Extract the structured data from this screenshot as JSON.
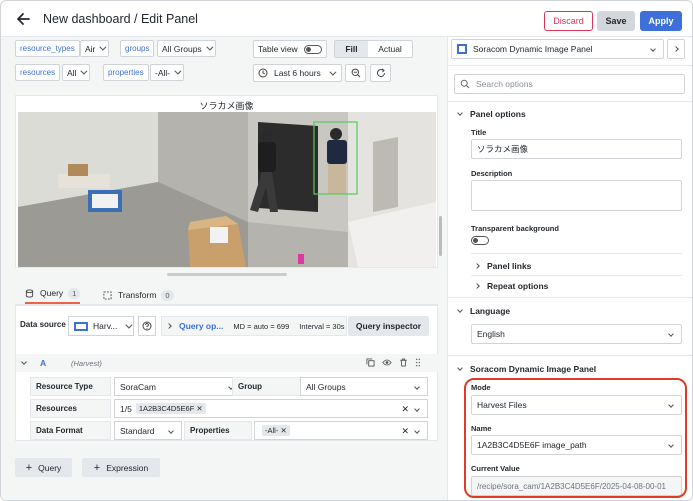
{
  "header": {
    "title": "New dashboard / Edit Panel",
    "discard_label": "Discard",
    "save_label": "Save",
    "apply_label": "Apply"
  },
  "variables": {
    "resource_types_label": "resource_types",
    "resource_types_value": "Air",
    "groups_label": "groups",
    "groups_value": "All Groups",
    "resources_label": "resources",
    "resources_value": "All",
    "properties_label": "properties",
    "properties_value": "-All-"
  },
  "view_controls": {
    "table_view_label": "Table view",
    "fill_label": "Fill",
    "actual_label": "Actual",
    "time_range": "Last 6 hours"
  },
  "panel": {
    "title": "ソラカメ画像"
  },
  "tabs": [
    {
      "label": "Query",
      "count": "1"
    },
    {
      "label": "Transform",
      "count": "0"
    }
  ],
  "query": {
    "data_source_label": "Data source",
    "data_source_value": "Harv...",
    "query_options_label": "Query op...",
    "md_info": "MD = auto = 699",
    "interval_info": "Interval = 30s",
    "inspector_label": "Query inspector",
    "ref_id": "A",
    "ref_source": "(Harvest)",
    "resource_type_label": "Resource Type",
    "resource_type_value": "SoraCam",
    "group_label": "Group",
    "group_value": "All Groups",
    "resources_label": "Resources",
    "resources_count": "1/5",
    "resources_chip": "1A2B3C4D5E6F",
    "data_format_label": "Data Format",
    "data_format_value": "Standard",
    "properties_label": "Properties",
    "properties_chip": "-All-",
    "add_query_label": "Query",
    "add_expression_label": "Expression"
  },
  "options_pane": {
    "visualization": "Soracom Dynamic Image Panel",
    "search_placeholder": "Search options",
    "panel_options_header": "Panel options",
    "title_label": "Title",
    "title_value": "ソラカメ画像",
    "description_label": "Description",
    "transparent_label": "Transparent background",
    "panel_links_label": "Panel links",
    "repeat_options_label": "Repeat options",
    "language_header": "Language",
    "language_value": "English",
    "plugin_header": "Soracom Dynamic Image Panel",
    "mode_label": "Mode",
    "mode_value": "Harvest Files",
    "name_label": "Name",
    "name_value": "1A2B3C4D5E6F image_path",
    "current_value_label": "Current Value",
    "current_value": "/recipe/sora_cam/1A2B3C4D5E6F/2025-04-08-00-01"
  },
  "colors": {
    "accent": "#3d71d9",
    "danger": "#d9365a",
    "highlight": "#e03b24",
    "detection_box": "#5ac85a"
  }
}
